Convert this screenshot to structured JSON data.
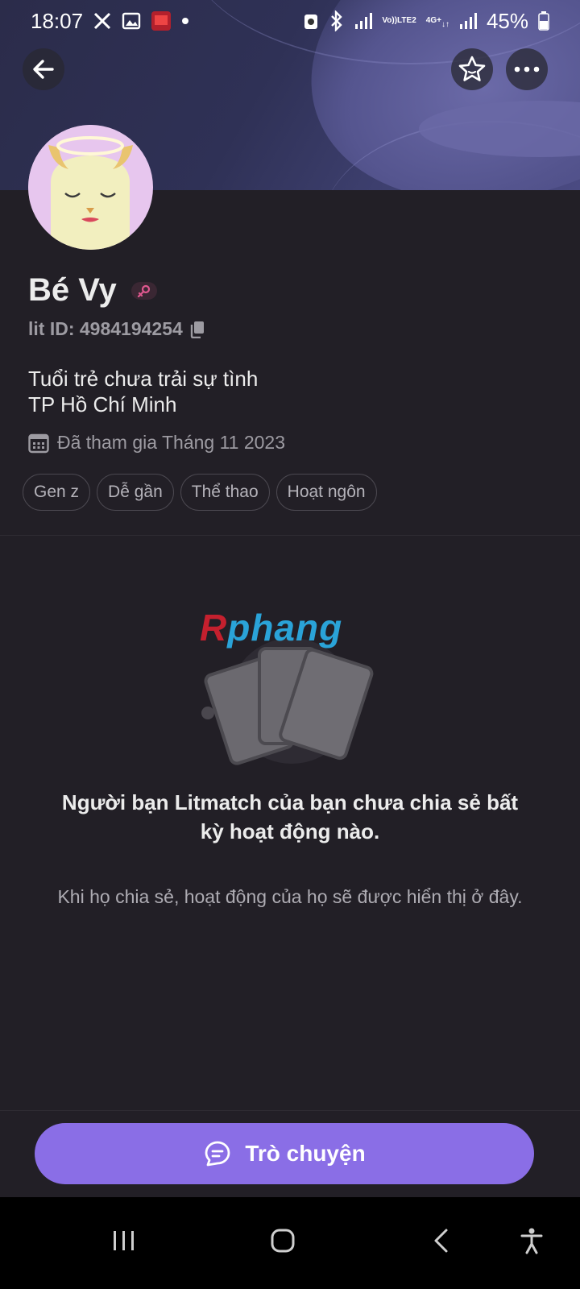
{
  "status_bar": {
    "time": "18:07",
    "signal_label_top": "Vo))",
    "signal_label_bottom": "LTE2",
    "network_label": "4G+",
    "battery": "45%"
  },
  "profile": {
    "name": "Bé Vy",
    "lit_id": "lit ID: 4984194254",
    "bio_line1": "Tuổi trẻ chưa trải sự tình",
    "bio_line2": "TP Hồ Chí Minh",
    "joined": "Đã tham gia Tháng 11 2023",
    "tags": [
      "Gen z",
      "Dễ gần",
      "Thể thao",
      "Hoạt ngôn"
    ]
  },
  "watermark": {
    "part1": "R",
    "part2": "phang"
  },
  "empty_state": {
    "title": "Người bạn Litmatch của bạn chưa chia sẻ bất kỳ hoạt động nào.",
    "subtitle": "Khi họ chia sẻ, hoạt động của họ sẽ được hiển thị ở đây."
  },
  "actions": {
    "chat_label": "Trò chuyện"
  },
  "icons": {
    "back": "arrow-left-icon",
    "favorite": "star-icon",
    "more": "more-icon",
    "copy": "copy-icon",
    "calendar": "calendar-icon",
    "chat": "chat-bubble-icon"
  },
  "colors": {
    "background": "#221f26",
    "accent": "#8a6ee6",
    "muted_text": "#9d9ba2",
    "gender_badge": "#e0588f"
  }
}
